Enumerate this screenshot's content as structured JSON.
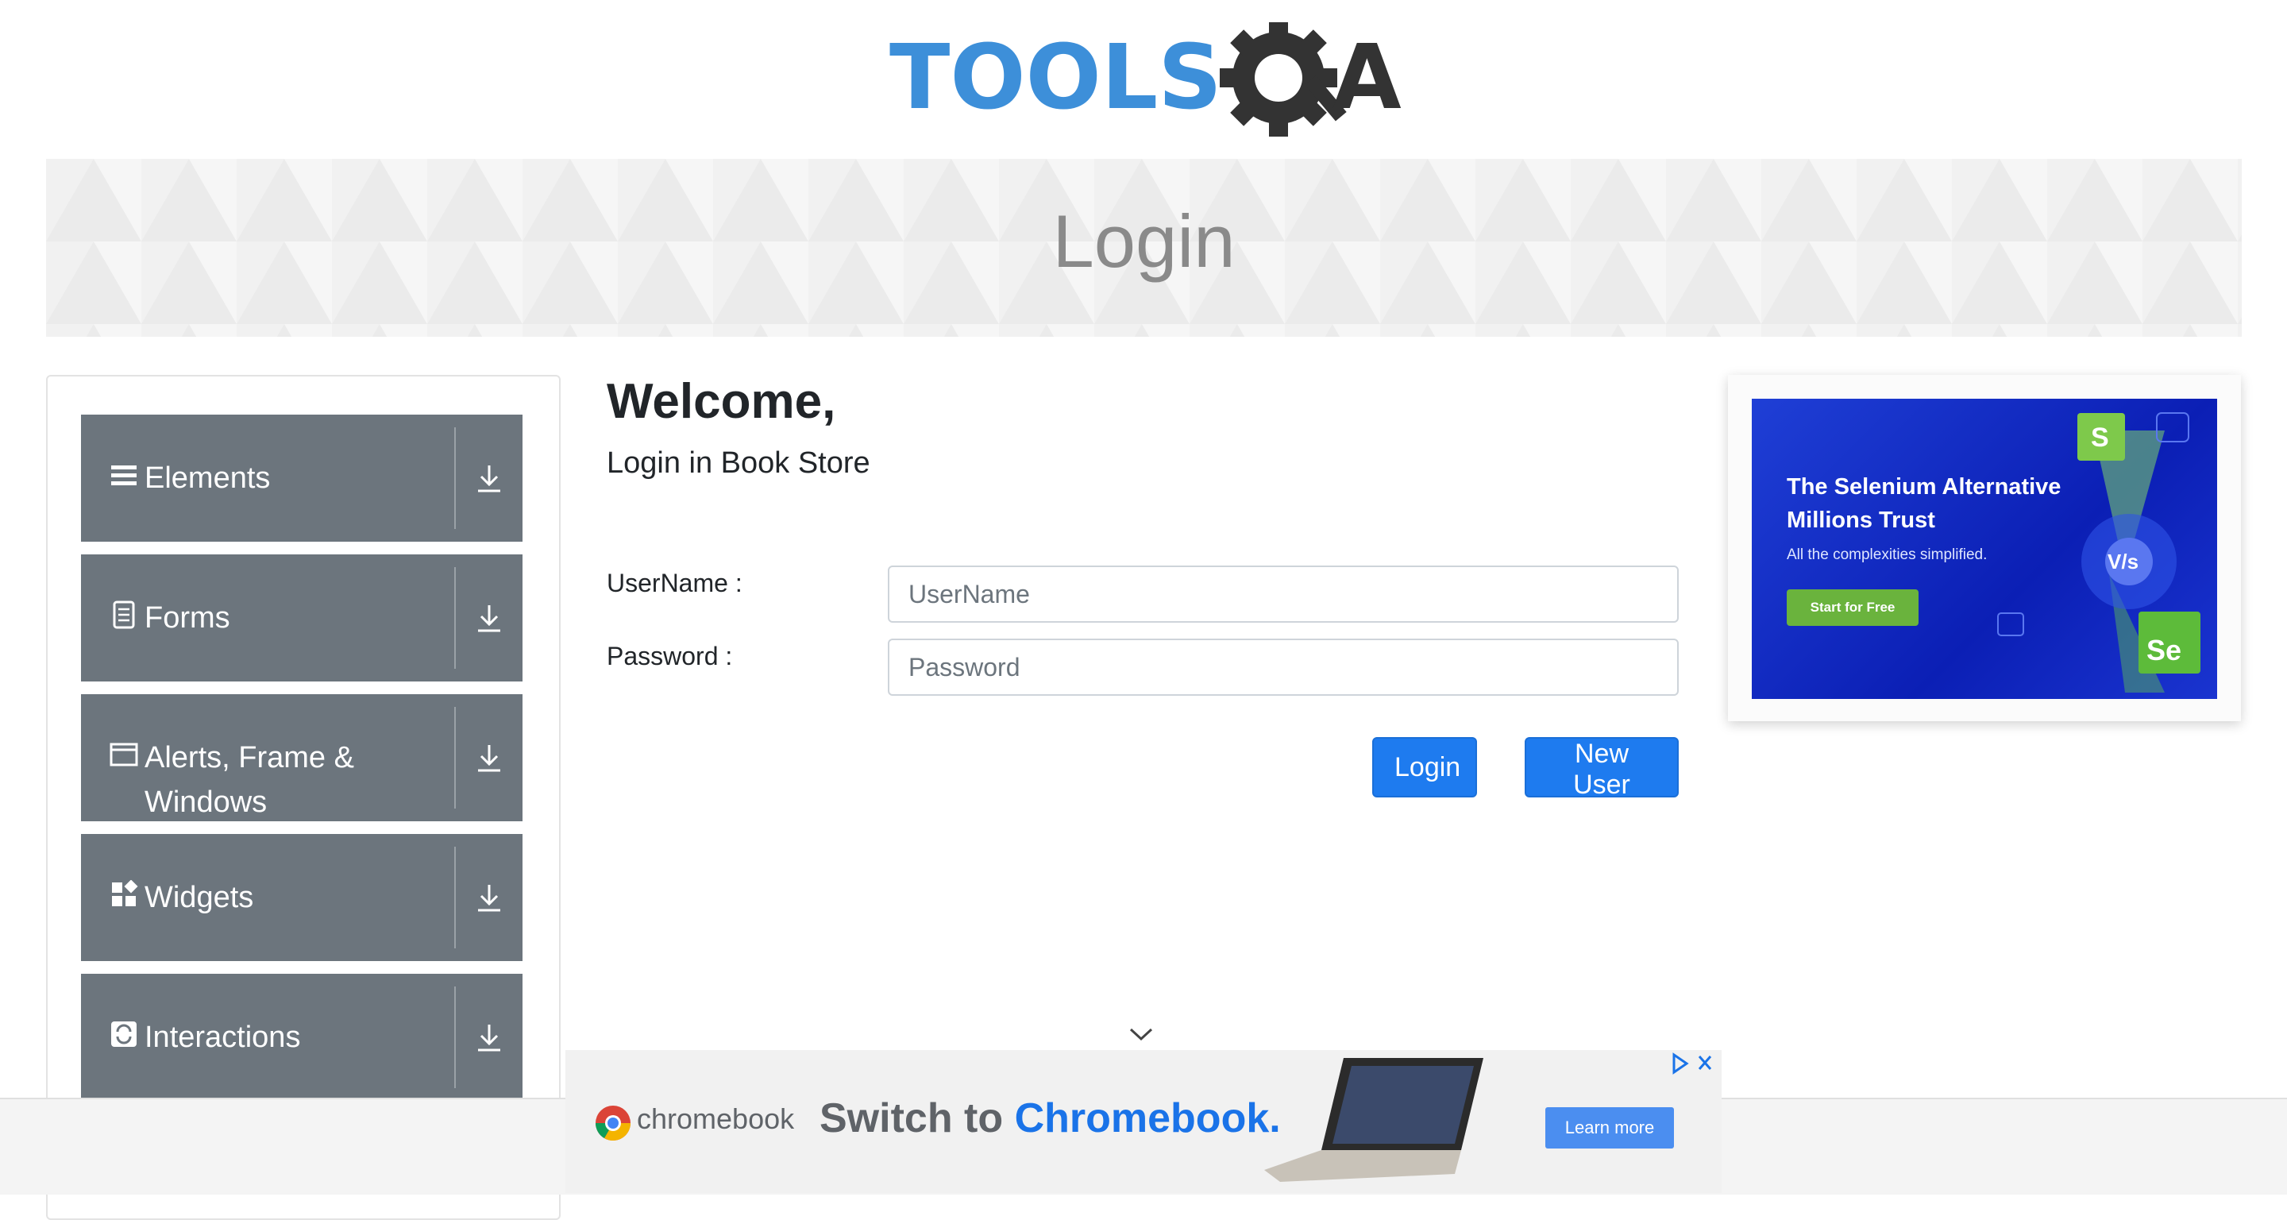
{
  "header": {
    "logo": {
      "text_main": "TOOLS",
      "text_end": "A",
      "icon": "gear-magnifier-icon",
      "color_blue": "#3d8fd9",
      "color_dark": "#333333"
    }
  },
  "banner": {
    "title": "Login"
  },
  "sidebar": {
    "groups": [
      {
        "label": "Elements",
        "icon": "menu-lines-icon"
      },
      {
        "label": "Forms",
        "icon": "document-icon"
      },
      {
        "label": "Alerts, Frame & Windows",
        "icon": "window-icon"
      },
      {
        "label": "Widgets",
        "icon": "widgets-icon"
      },
      {
        "label": "Interactions",
        "icon": "refresh-icon"
      }
    ]
  },
  "main": {
    "welcome": "Welcome,",
    "subtitle": "Login in Book Store",
    "username_label": "UserName :",
    "username_placeholder": "UserName",
    "password_label": "Password :",
    "password_placeholder": "Password",
    "login_button": "Login",
    "new_user_button": "New User"
  },
  "side_ad": {
    "title": "The Selenium Alternative Millions Trust",
    "subtitle": "All the complexities simplified.",
    "cta": "Start for Free",
    "vs": "V/s",
    "badge_s": "S",
    "badge_se": "Se"
  },
  "bottom_ad": {
    "brand": "chromebook",
    "headline_prefix": "Switch to ",
    "headline_highlight": "Chromebook.",
    "cta": "Learn more"
  },
  "colors": {
    "primary": "#1e7bef",
    "sidebar": "#6c757d"
  }
}
